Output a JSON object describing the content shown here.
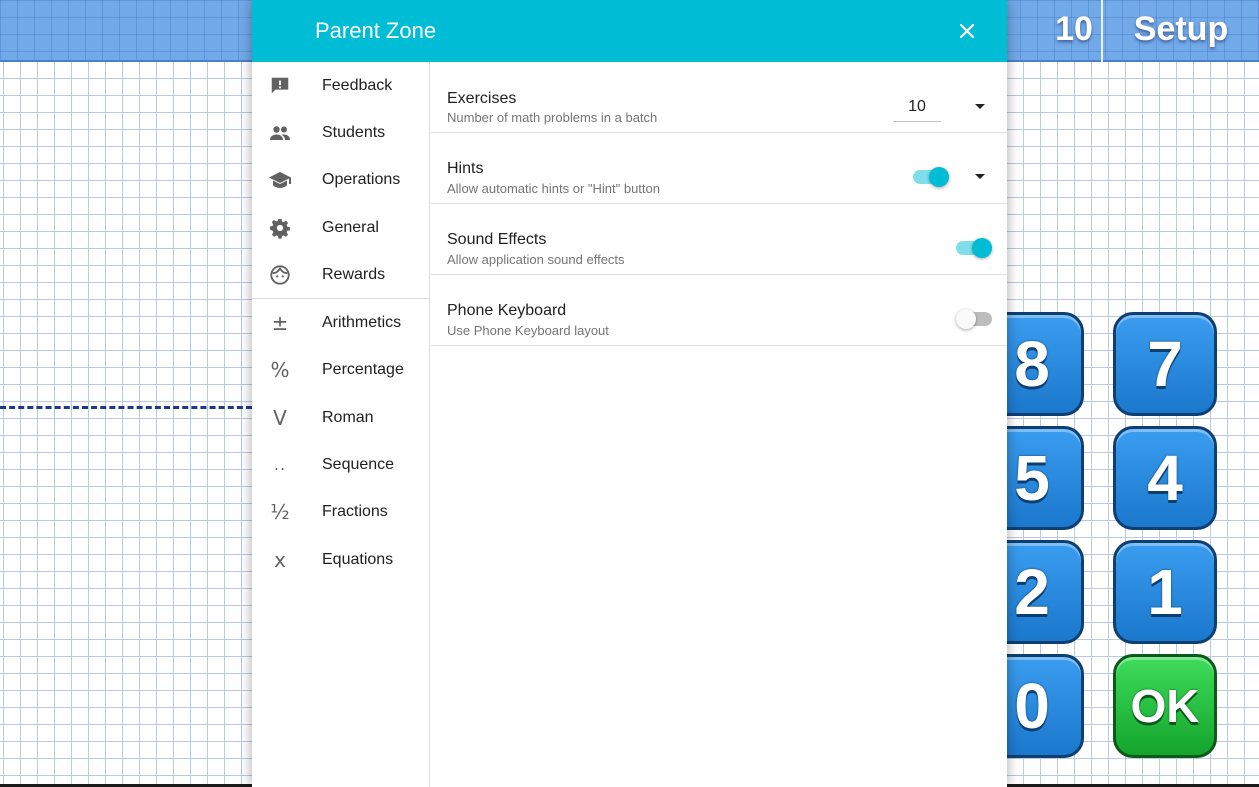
{
  "app": {
    "batch_count": "10",
    "setup_label": "Setup",
    "keypad": [
      "8",
      "7",
      "5",
      "4",
      "2",
      "1",
      "0",
      "OK"
    ]
  },
  "dialog": {
    "title": "Parent Zone",
    "close_icon": "close-icon"
  },
  "sidebar": {
    "items": [
      {
        "label": "Feedback",
        "icon": "feedback-icon"
      },
      {
        "label": "Students",
        "icon": "people-icon"
      },
      {
        "label": "Operations",
        "icon": "school-icon"
      },
      {
        "label": "General",
        "icon": "gear-icon"
      },
      {
        "label": "Rewards",
        "icon": "face-icon"
      },
      {
        "label": "Arithmetics",
        "icon": "plus-minus-icon",
        "glyph": "±"
      },
      {
        "label": "Percentage",
        "icon": "percent-icon",
        "glyph": "%"
      },
      {
        "label": "Roman",
        "icon": "roman-icon",
        "glyph": "V"
      },
      {
        "label": "Sequence",
        "icon": "sequence-icon",
        "glyph": ".."
      },
      {
        "label": "Fractions",
        "icon": "fraction-icon",
        "glyph": "½"
      },
      {
        "label": "Equations",
        "icon": "equation-icon",
        "glyph": "x"
      }
    ]
  },
  "settings": [
    {
      "title": "Exercises",
      "desc": "Number of math problems in a batch",
      "value": "10"
    },
    {
      "title": "Hints",
      "desc": "Allow automatic hints or \"Hint\" button",
      "on": true
    },
    {
      "title": "Sound Effects",
      "desc": "Allow application sound effects",
      "on": true
    },
    {
      "title": "Phone Keyboard",
      "desc": "Use Phone Keyboard layout",
      "on": false
    }
  ],
  "colors": {
    "accent": "#00bcd4",
    "keypad_blue": "#1b78cc",
    "keypad_green": "#13a42c"
  }
}
